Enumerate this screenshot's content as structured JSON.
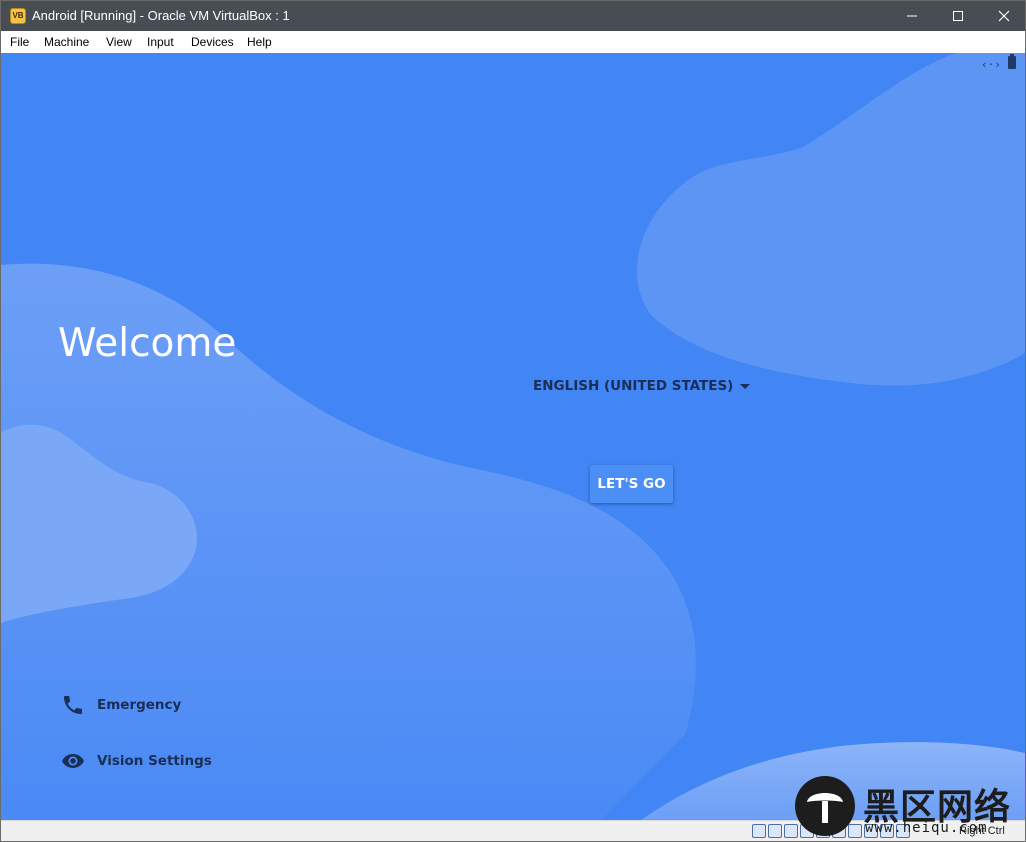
{
  "window": {
    "title": "Android [Running] - Oracle VM VirtualBox : 1",
    "app_icon": "virtualbox-icon"
  },
  "menubar": {
    "items": [
      "File",
      "Machine",
      "View",
      "Input",
      "Devices",
      "Help"
    ]
  },
  "guest": {
    "background_color": "#4285f4",
    "welcome_title": "Welcome",
    "language_selector": "ENGLISH (UNITED STATES)",
    "start_button": "LET'S GO",
    "emergency_label": "Emergency",
    "vision_label": "Vision Settings",
    "status_icons": [
      "code-brackets-icon",
      "battery-icon"
    ]
  },
  "statusbar": {
    "host_key": "Right Ctrl",
    "icons": [
      "hard-disk-icon",
      "optical-drive-icon",
      "audio-icon",
      "network-icon",
      "usb-icon",
      "shared-folder-icon",
      "display-icon",
      "video-capture-icon",
      "cpu-icon",
      "mouse-integration-icon"
    ]
  },
  "watermark": {
    "characters": "黑区网络",
    "url": "www.heiqu.com"
  }
}
